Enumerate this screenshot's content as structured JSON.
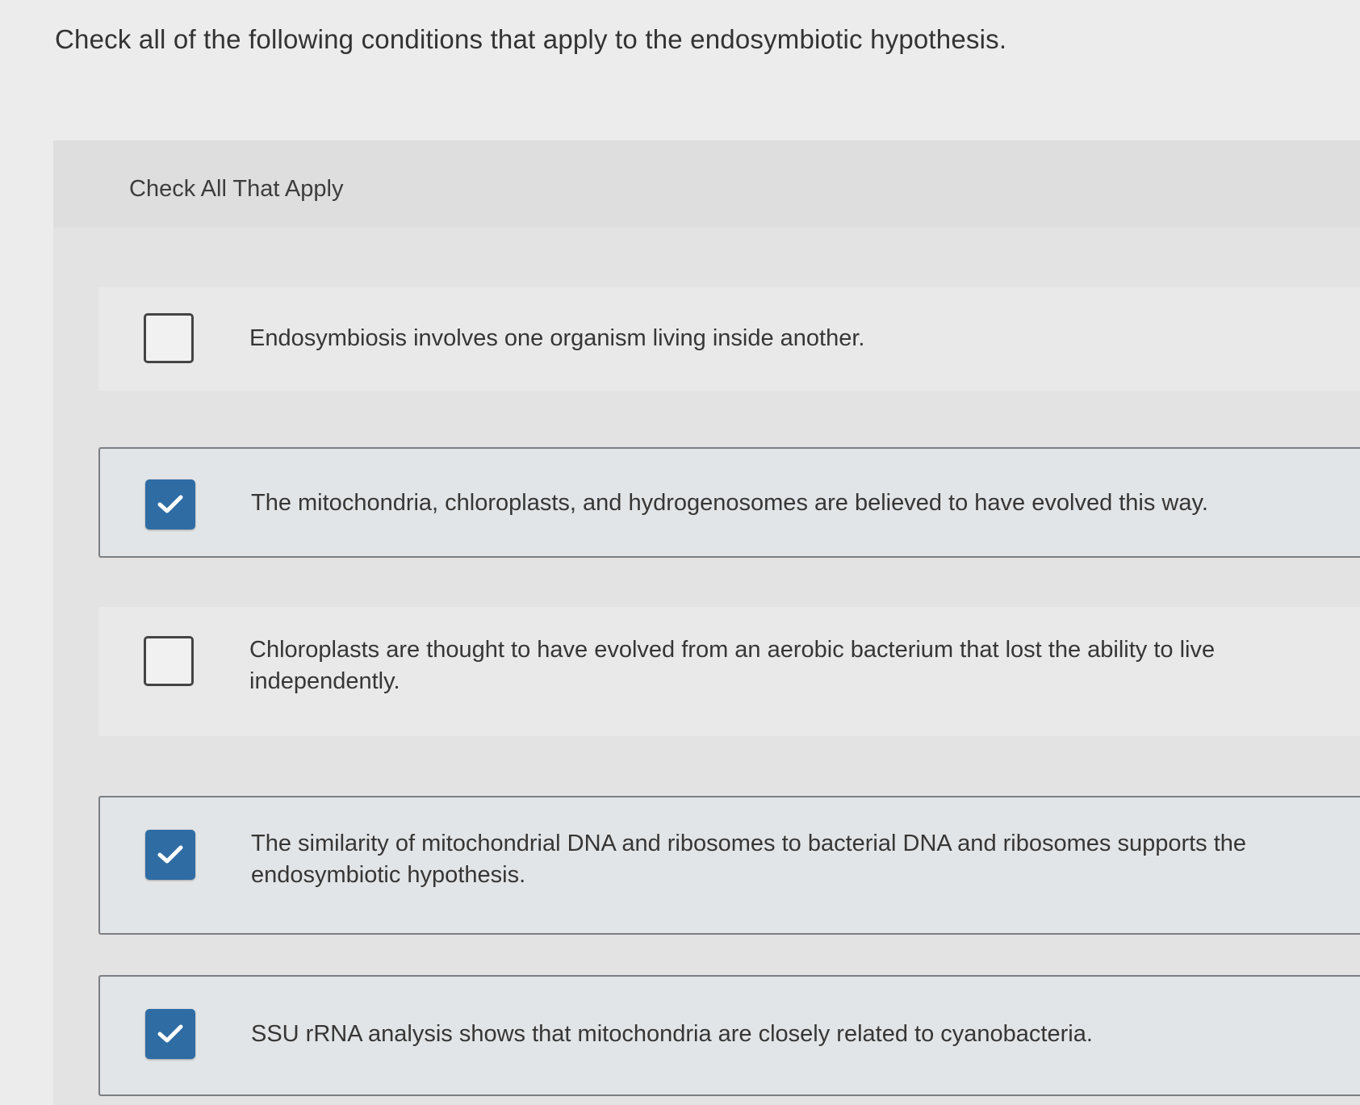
{
  "question": {
    "text": "Check all of the following conditions that apply to the endosymbiotic hypothesis."
  },
  "instruction": "Check All That Apply",
  "options": [
    {
      "text": "Endosymbiosis involves one organism living inside another.",
      "checked": false,
      "checkbox_icon": "empty-checkbox"
    },
    {
      "text": "The mitochondria, chloroplasts, and hydrogenosomes are believed to have evolved this way.",
      "checked": true,
      "checkbox_icon": "checkmark-icon"
    },
    {
      "text": "Chloroplasts are thought to have evolved from an aerobic bacterium that lost the ability to live independently.",
      "checked": false,
      "checkbox_icon": "empty-checkbox"
    },
    {
      "text": "The similarity of mitochondrial DNA and ribosomes to bacterial DNA and ribosomes supports the endosymbiotic hypothesis.",
      "checked": true,
      "checkbox_icon": "checkmark-icon"
    },
    {
      "text": "SSU rRNA analysis shows that mitochondria are closely related to cyanobacteria.",
      "checked": true,
      "checkbox_icon": "checkmark-icon"
    }
  ],
  "colors": {
    "checked_fill": "#2f6ca4",
    "page_background": "#ececec",
    "selected_border": "#7b7f83"
  }
}
